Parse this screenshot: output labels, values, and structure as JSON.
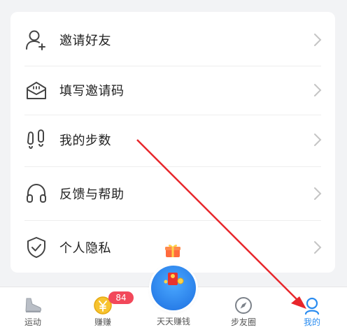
{
  "menu": {
    "items": [
      {
        "label": "邀请好友",
        "icon": "add-user-icon"
      },
      {
        "label": "填写邀请码",
        "icon": "envelope-icon"
      },
      {
        "label": "我的步数",
        "icon": "footprints-icon"
      },
      {
        "label": "反馈与帮助",
        "icon": "headphones-icon"
      },
      {
        "label": "个人隐私",
        "icon": "shield-check-icon"
      }
    ]
  },
  "tabbar": {
    "tabs": [
      {
        "label": "运动",
        "icon": "shoe-icon"
      },
      {
        "label": "赚赚",
        "icon": "coin-icon",
        "badge": "84"
      },
      {
        "label": "天天赚钱",
        "icon": "gift-ball-icon"
      },
      {
        "label": "步友圈",
        "icon": "compass-icon"
      },
      {
        "label": "我的",
        "icon": "profile-icon",
        "active": true
      }
    ]
  },
  "colors": {
    "accent": "#2a8cf0",
    "badge": "#f2485a",
    "arrow": "#e8262b"
  }
}
